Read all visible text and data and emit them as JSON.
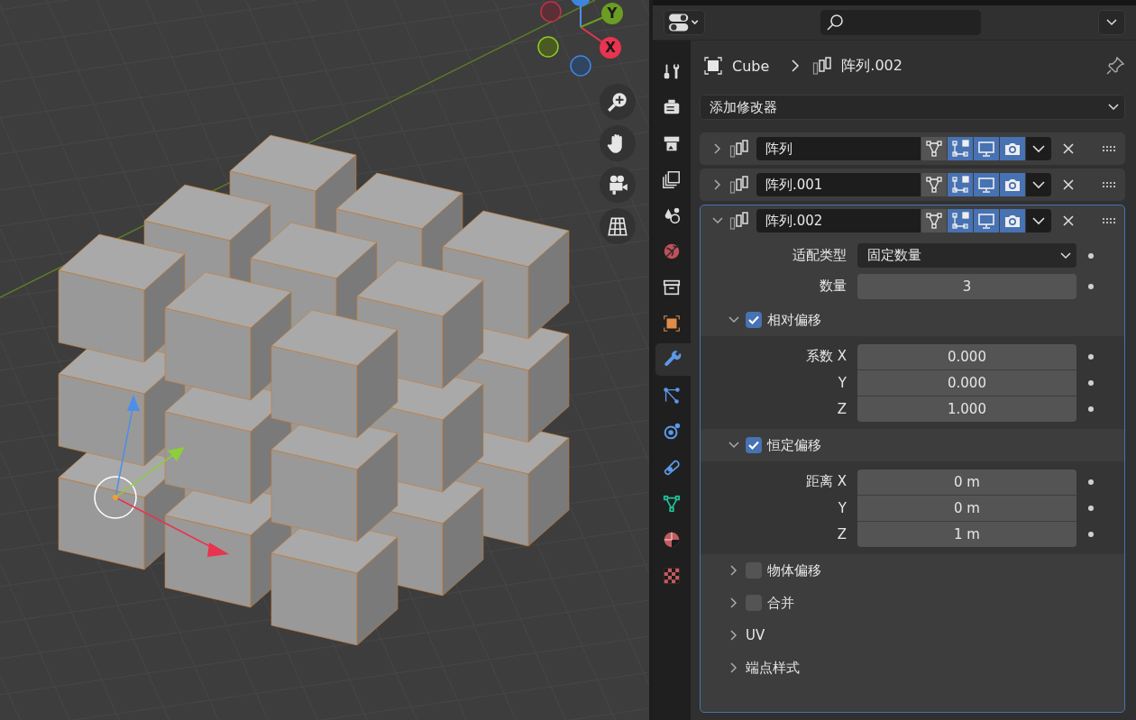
{
  "viewport": {
    "gizmo": [
      {
        "label": "Y",
        "color": "#6b9d22"
      },
      {
        "label": "X",
        "color": "#e8344f"
      }
    ]
  },
  "property_tabs": [
    {
      "kind": "tool",
      "selected": false
    },
    {
      "kind": "render",
      "selected": false
    },
    {
      "kind": "output",
      "selected": false
    },
    {
      "kind": "view-layer",
      "selected": false
    },
    {
      "kind": "scene",
      "selected": false
    },
    {
      "kind": "world",
      "selected": false
    },
    {
      "kind": "collection",
      "selected": false
    },
    {
      "kind": "object",
      "selected": false
    },
    {
      "kind": "modifier",
      "selected": true
    },
    {
      "kind": "particles",
      "selected": false
    },
    {
      "kind": "physics",
      "selected": false
    },
    {
      "kind": "constraints",
      "selected": false
    },
    {
      "kind": "data",
      "selected": false
    },
    {
      "kind": "material",
      "selected": false
    },
    {
      "kind": "texture",
      "selected": false
    }
  ],
  "breadcrumb": {
    "object": "Cube",
    "modifier": "阵列.002"
  },
  "add_modifier": "添加修改器",
  "modifiers": [
    {
      "name": "阵列",
      "expanded": false,
      "on_cage": false,
      "edit_mode": true,
      "viewport": true,
      "render": true
    },
    {
      "name": "阵列.001",
      "expanded": false,
      "on_cage": false,
      "edit_mode": true,
      "viewport": true,
      "render": true
    },
    {
      "name": "阵列.002",
      "expanded": true,
      "on_cage": false,
      "edit_mode": true,
      "viewport": true,
      "render": true
    }
  ],
  "settings": [
    {
      "kind": "dropdown",
      "label": "适配类型",
      "value": "固定数量"
    },
    {
      "kind": "number",
      "label": "数量",
      "value": "3"
    }
  ],
  "sections": [
    {
      "kind": "toggle",
      "title": "相对偏移",
      "expanded": true,
      "checked": true,
      "fields": [
        {
          "label": "系数 X",
          "value": "0.000"
        },
        {
          "label": "Y",
          "value": "0.000"
        },
        {
          "label": "Z",
          "value": "1.000"
        }
      ]
    },
    {
      "kind": "toggle",
      "title": "恒定偏移",
      "expanded": true,
      "checked": true,
      "fields": [
        {
          "label": "距离 X",
          "value": "0 m"
        },
        {
          "label": "Y",
          "value": "0 m"
        },
        {
          "label": "Z",
          "value": "1 m"
        }
      ]
    },
    {
      "kind": "toggle",
      "title": "物体偏移",
      "expanded": false,
      "checked": false
    },
    {
      "kind": "toggle",
      "title": "合并",
      "expanded": false,
      "checked": false
    },
    {
      "kind": "plain",
      "title": "UV",
      "expanded": false
    },
    {
      "kind": "plain",
      "title": "端点样式",
      "expanded": false
    }
  ]
}
